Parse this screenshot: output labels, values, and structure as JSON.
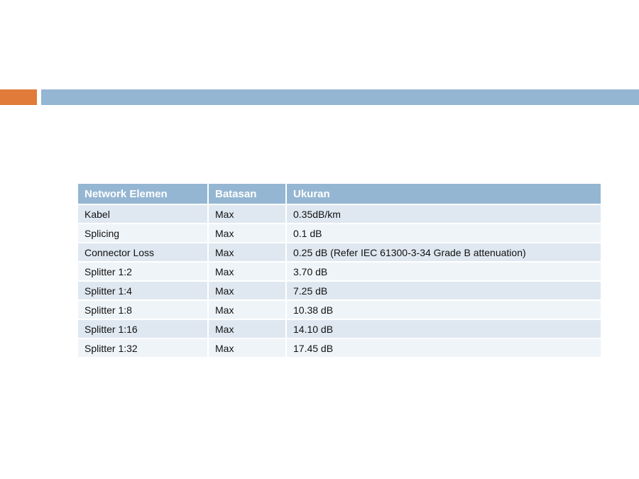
{
  "slide": {
    "accent_color_left": "#e07b39",
    "accent_color_right": "#94b6d2"
  },
  "table": {
    "headers": [
      "Network Elemen",
      "Batasan",
      "Ukuran"
    ],
    "rows": [
      [
        "Kabel",
        "Max",
        "0.35dB/km"
      ],
      [
        "Splicing",
        "Max",
        "0.1 dB"
      ],
      [
        "Connector Loss",
        "Max",
        "0.25 dB (Refer IEC 61300-3-34 Grade B attenuation)"
      ],
      [
        "Splitter 1:2",
        "Max",
        "3.70 dB"
      ],
      [
        "Splitter 1:4",
        "Max",
        "7.25 dB"
      ],
      [
        "Splitter 1:8",
        "Max",
        "10.38 dB"
      ],
      [
        "Splitter 1:16",
        "Max",
        "14.10 dB"
      ],
      [
        "Splitter 1:32",
        "Max",
        "17.45 dB"
      ]
    ]
  }
}
